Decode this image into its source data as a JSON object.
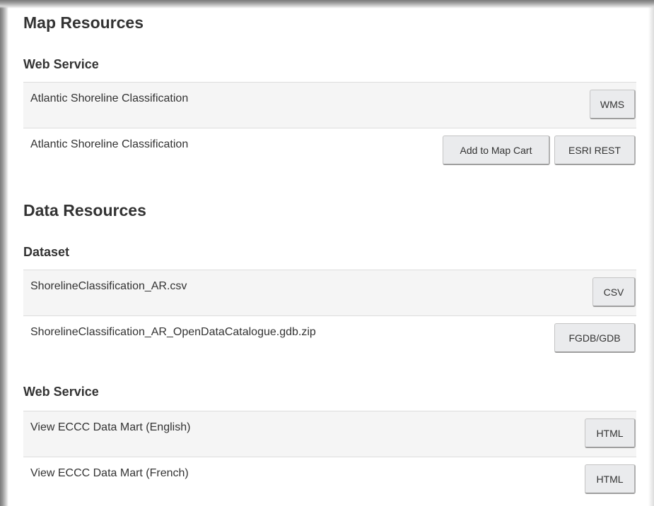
{
  "map_resources": {
    "title": "Map Resources",
    "web_service": {
      "title": "Web Service",
      "rows": [
        {
          "label": "Atlantic Shoreline Classification",
          "buttons": [
            "WMS"
          ]
        },
        {
          "label": "Atlantic Shoreline Classification",
          "buttons": [
            "Add to Map Cart",
            "ESRI REST"
          ]
        }
      ]
    }
  },
  "data_resources": {
    "title": "Data Resources",
    "dataset": {
      "title": "Dataset",
      "rows": [
        {
          "label": "ShorelineClassification_AR.csv",
          "buttons": [
            "CSV"
          ]
        },
        {
          "label": "ShorelineClassification_AR_OpenDataCatalogue.gdb.zip",
          "buttons": [
            "FGDB/GDB"
          ]
        }
      ]
    },
    "web_service": {
      "title": "Web Service",
      "rows": [
        {
          "label": "View ECCC Data Mart (English)",
          "buttons": [
            "HTML"
          ]
        },
        {
          "label": "View ECCC Data Mart (French)",
          "buttons": [
            "HTML"
          ]
        }
      ]
    }
  }
}
